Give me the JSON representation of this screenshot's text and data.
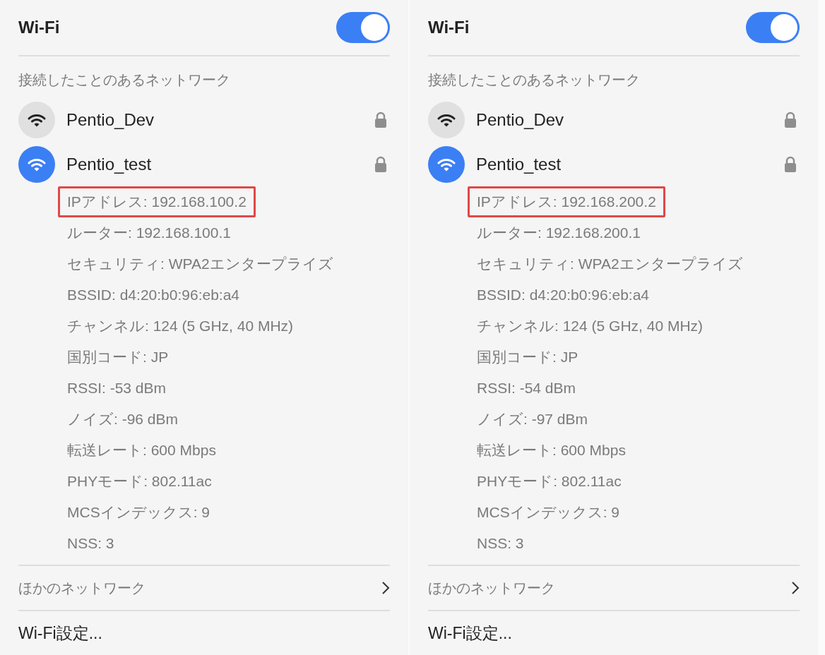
{
  "panels": [
    {
      "title": "Wi-Fi",
      "wifi_on": true,
      "section_heading": "接続したことのあるネットワーク",
      "networks": [
        {
          "name": "Pentio_Dev",
          "selected": false,
          "locked": true
        },
        {
          "name": "Pentio_test",
          "selected": true,
          "locked": true
        }
      ],
      "details": [
        {
          "text": "IPアドレス: 192.168.100.2",
          "highlighted": true
        },
        {
          "text": "ルーター: 192.168.100.1",
          "highlighted": false
        },
        {
          "text": "セキュリティ: WPA2エンタープライズ",
          "highlighted": false
        },
        {
          "text": "BSSID: d4:20:b0:96:eb:a4",
          "highlighted": false
        },
        {
          "text": "チャンネル: 124 (5 GHz, 40 MHz)",
          "highlighted": false
        },
        {
          "text": "国別コード: JP",
          "highlighted": false
        },
        {
          "text": "RSSI: -53 dBm",
          "highlighted": false
        },
        {
          "text": "ノイズ: -96 dBm",
          "highlighted": false
        },
        {
          "text": "転送レート: 600 Mbps",
          "highlighted": false
        },
        {
          "text": "PHYモード: 802.11ac",
          "highlighted": false
        },
        {
          "text": "MCSインデックス: 9",
          "highlighted": false
        },
        {
          "text": "NSS: 3",
          "highlighted": false
        }
      ],
      "other_networks": "ほかのネットワーク",
      "settings": "Wi-Fi設定..."
    },
    {
      "title": "Wi-Fi",
      "wifi_on": true,
      "section_heading": "接続したことのあるネットワーク",
      "networks": [
        {
          "name": "Pentio_Dev",
          "selected": false,
          "locked": true
        },
        {
          "name": "Pentio_test",
          "selected": true,
          "locked": true
        }
      ],
      "details": [
        {
          "text": "IPアドレス: 192.168.200.2",
          "highlighted": true
        },
        {
          "text": "ルーター: 192.168.200.1",
          "highlighted": false
        },
        {
          "text": "セキュリティ: WPA2エンタープライズ",
          "highlighted": false
        },
        {
          "text": "BSSID: d4:20:b0:96:eb:a4",
          "highlighted": false
        },
        {
          "text": "チャンネル: 124 (5 GHz, 40 MHz)",
          "highlighted": false
        },
        {
          "text": "国別コード: JP",
          "highlighted": false
        },
        {
          "text": "RSSI: -54 dBm",
          "highlighted": false
        },
        {
          "text": "ノイズ: -97 dBm",
          "highlighted": false
        },
        {
          "text": "転送レート: 600 Mbps",
          "highlighted": false
        },
        {
          "text": "PHYモード: 802.11ac",
          "highlighted": false
        },
        {
          "text": "MCSインデックス: 9",
          "highlighted": false
        },
        {
          "text": "NSS: 3",
          "highlighted": false
        }
      ],
      "other_networks": "ほかのネットワーク",
      "settings": "Wi-Fi設定..."
    }
  ]
}
